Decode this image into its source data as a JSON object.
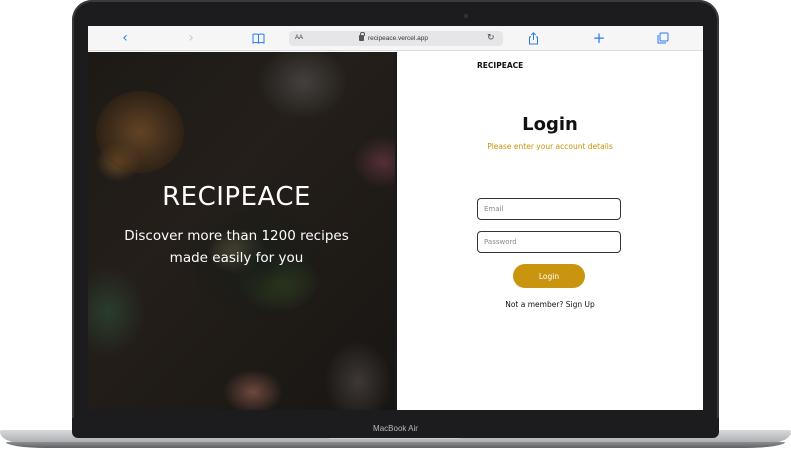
{
  "browser": {
    "url_text_size": "AA",
    "url": "recipeace.vercel.app",
    "icons": {
      "back": "chevron-left-icon",
      "forward": "chevron-right-icon",
      "bookmarks": "book-icon",
      "lock": "lock-icon",
      "reload": "reload-icon",
      "share": "share-icon",
      "new_tab": "plus-icon",
      "tabs": "tabs-icon"
    }
  },
  "hero": {
    "title": "RECIPEACE",
    "subtitle": "Discover more than 1200 recipes made easily for you"
  },
  "panel": {
    "brand": "RECIPEACE",
    "title": "Login",
    "subtitle": "Please enter your account details",
    "email_placeholder": "Email",
    "password_placeholder": "Password",
    "login_label": "Login",
    "signup_prefix": "Not a member? ",
    "signup_link": "Sign Up"
  },
  "device": {
    "label": "MacBook Air"
  },
  "colors": {
    "accent": "#c9950e",
    "subtitle": "#c8920a",
    "browser_blue": "#2b7bf2"
  }
}
